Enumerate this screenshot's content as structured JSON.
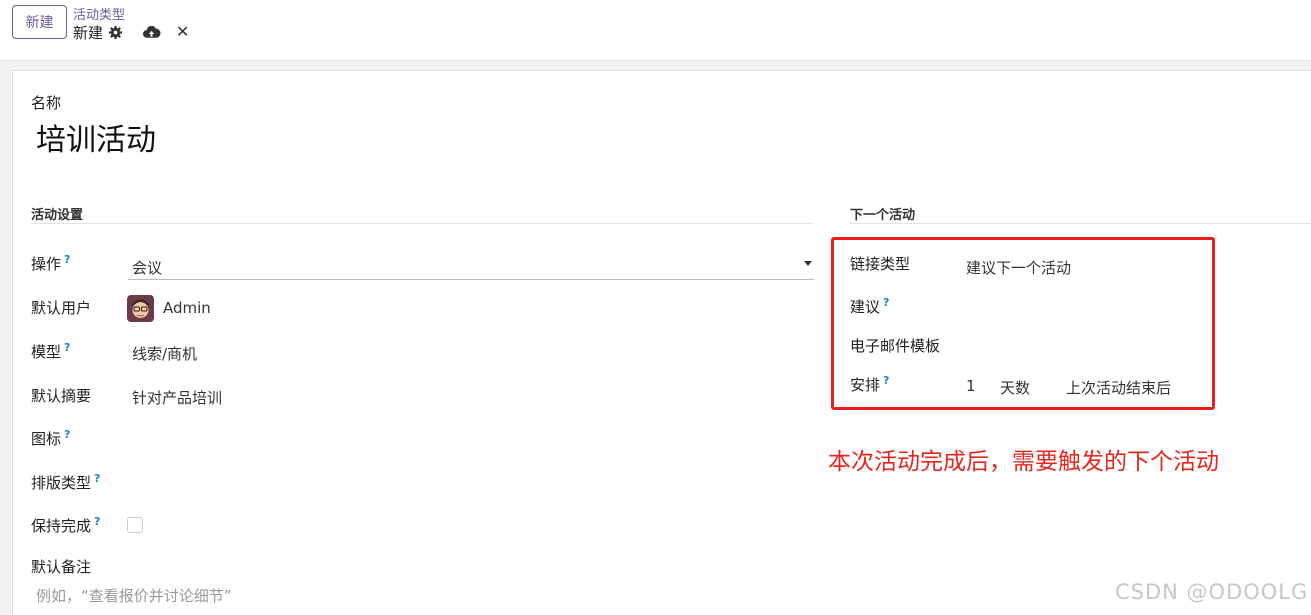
{
  "toolbar": {
    "new_button": "新建",
    "breadcrumb": "活动类型",
    "record_title": "新建",
    "icons": [
      "gear-icon",
      "cloud-upload-icon",
      "close-icon"
    ]
  },
  "form": {
    "name_label": "名称",
    "name_value": "培训活动",
    "left_section": {
      "title": "活动设置",
      "fields": {
        "action": {
          "label": "操作",
          "help": "?",
          "value": "会议"
        },
        "default_user": {
          "label": "默认用户",
          "value": "Admin"
        },
        "model": {
          "label": "模型",
          "help": "?",
          "value": "线索/商机"
        },
        "default_summary": {
          "label": "默认摘要",
          "value": "针对产品培训"
        },
        "icon": {
          "label": "图标",
          "help": "?"
        },
        "decoration_type": {
          "label": "排版类型",
          "help": "?"
        },
        "keep_done": {
          "label": "保持完成",
          "help": "?",
          "checked": false
        },
        "default_note": {
          "label": "默认备注",
          "placeholder": "例如，“查看报价并讨论细节”"
        }
      }
    },
    "right_section": {
      "title": "下一个活动",
      "fields": {
        "chaining_type": {
          "label": "链接类型",
          "value": "建议下一个活动"
        },
        "suggest": {
          "label": "建议",
          "help": "?"
        },
        "mail_template": {
          "label": "电子邮件模板"
        },
        "schedule": {
          "label": "安排",
          "help": "?",
          "delay": "1",
          "unit": "天数",
          "from": "上次活动结束后"
        }
      }
    }
  },
  "annotation": {
    "text": "本次活动完成后，需要触发的下个活动",
    "color": "#ee1c1c"
  },
  "watermark": "CSDN @ODOOLG",
  "colors": {
    "accent": "#6c5b9b",
    "help": "#1a8ab8",
    "annotation": "#e8261d"
  }
}
